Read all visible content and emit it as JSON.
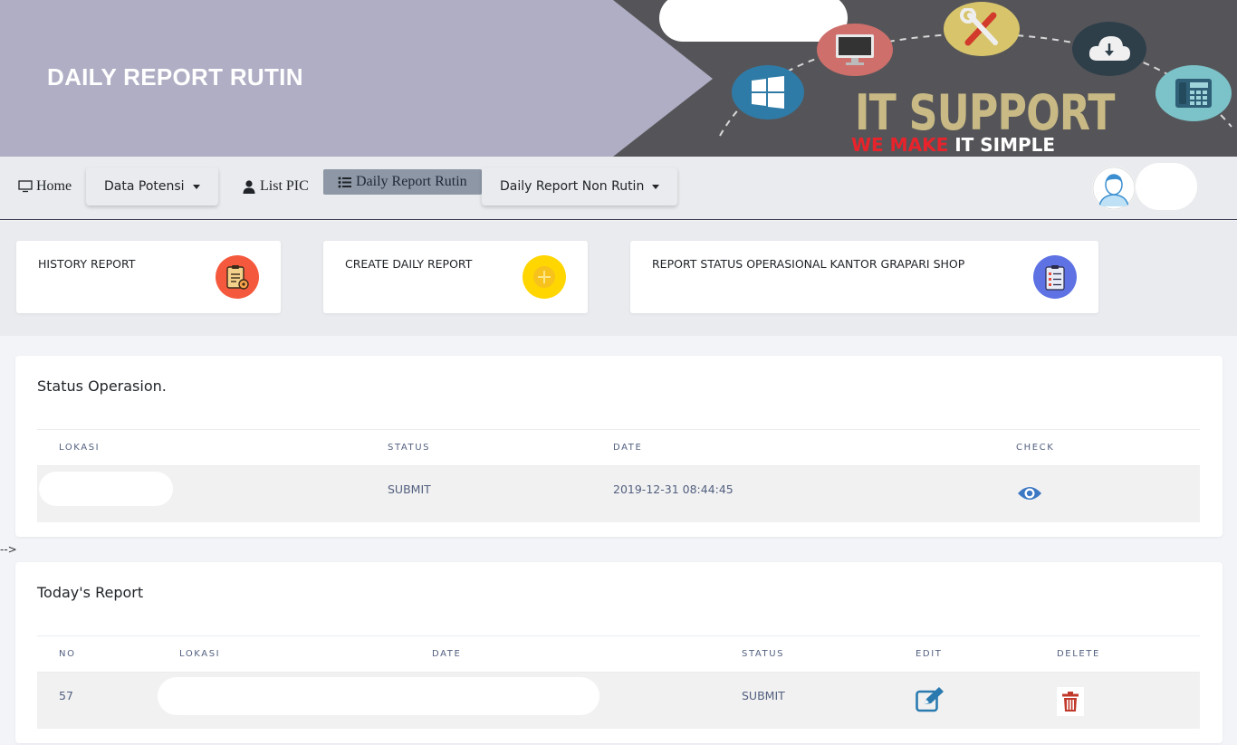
{
  "banner": {
    "title": "DAILY REPORT RUTIN",
    "logo_main": "IT SUPPORT",
    "tagline_red": "WE MAKE",
    "tagline_white": "IT SIMPLE",
    "icons": [
      "windows-icon",
      "monitor-icon",
      "tools-icon",
      "cloud-download-icon",
      "phone-icon"
    ]
  },
  "nav": {
    "home": "Home",
    "data_potensi": "Data Potensi",
    "list_pic": "List PIC",
    "daily_report_rutin": "Daily Report Rutin",
    "daily_report_non_rutin": "Daily Report Non Rutin"
  },
  "cards": [
    {
      "title": "HISTORY REPORT",
      "icon": "clipboard-gear-icon",
      "color": "#f5593d"
    },
    {
      "title": "CREATE DAILY REPORT",
      "icon": "plus-icon",
      "color": "#ffd600"
    },
    {
      "title": "REPORT STATUS OPERASIONAL KANTOR GRAPARI SHOP",
      "icon": "checklist-icon",
      "color": "#5e72e4"
    }
  ],
  "status_panel": {
    "title": "Status Operasion.",
    "headers": {
      "lokasi": "LOKASI",
      "status": "STATUS",
      "date": "DATE",
      "check": "CHECK"
    },
    "rows": [
      {
        "lokasi": "",
        "status": "SUBMIT",
        "date": "2019-12-31 08:44:45",
        "check_icon": "eye-icon"
      }
    ]
  },
  "stray_text": "-->",
  "today_panel": {
    "title": "Today's Report",
    "headers": {
      "no": "NO",
      "lokasi": "LOKASI",
      "date": "DATE",
      "status": "STATUS",
      "edit": "EDIT",
      "delete": "DELETE"
    },
    "rows": [
      {
        "no": "57",
        "lokasi": "",
        "date": "",
        "status": "SUBMIT",
        "edit_icon": "edit-icon",
        "delete_icon": "trash-icon"
      }
    ]
  },
  "colors": {
    "banner_left": "#afaec4",
    "banner_right": "#555559",
    "nav_active": "#8d97a6",
    "eye": "#3c78c3",
    "edit": "#2a7ab0",
    "delete": "#c0392b"
  }
}
